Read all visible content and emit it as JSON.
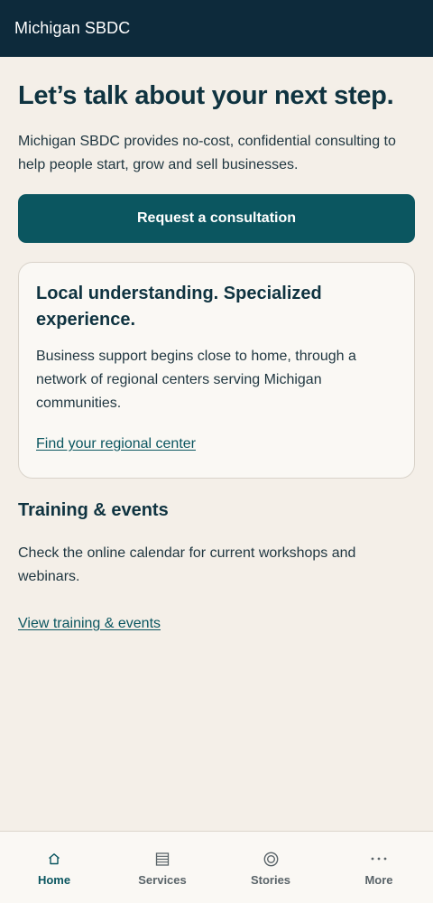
{
  "header": {
    "title": "Michigan SBDC"
  },
  "hero": {
    "title": "Let’s talk about your next step.",
    "text": "Michigan SBDC provides no-cost, confidential consulting to help people start, grow and sell businesses.",
    "cta_label": "Request a consultation"
  },
  "card": {
    "title": "Local understanding. Specialized experience.",
    "text": "Business support begins close to home, through a network of regional centers serving Michigan communities.",
    "link_label": "Find your regional center"
  },
  "training": {
    "title": "Training & events",
    "text": "Check the online calendar for current workshops and webinars.",
    "link_label": "View training & events"
  },
  "bottom_nav": {
    "items": [
      {
        "label": "Home",
        "icon": "home-icon",
        "active": true
      },
      {
        "label": "Services",
        "icon": "list-icon",
        "active": false
      },
      {
        "label": "Stories",
        "icon": "target-icon",
        "active": false
      },
      {
        "label": "More",
        "icon": "more-icon",
        "active": false
      }
    ]
  },
  "colors": {
    "header_bg": "#0d2a3b",
    "page_bg": "#f4efe8",
    "accent": "#0b5660",
    "card_bg": "#faf8f4"
  }
}
